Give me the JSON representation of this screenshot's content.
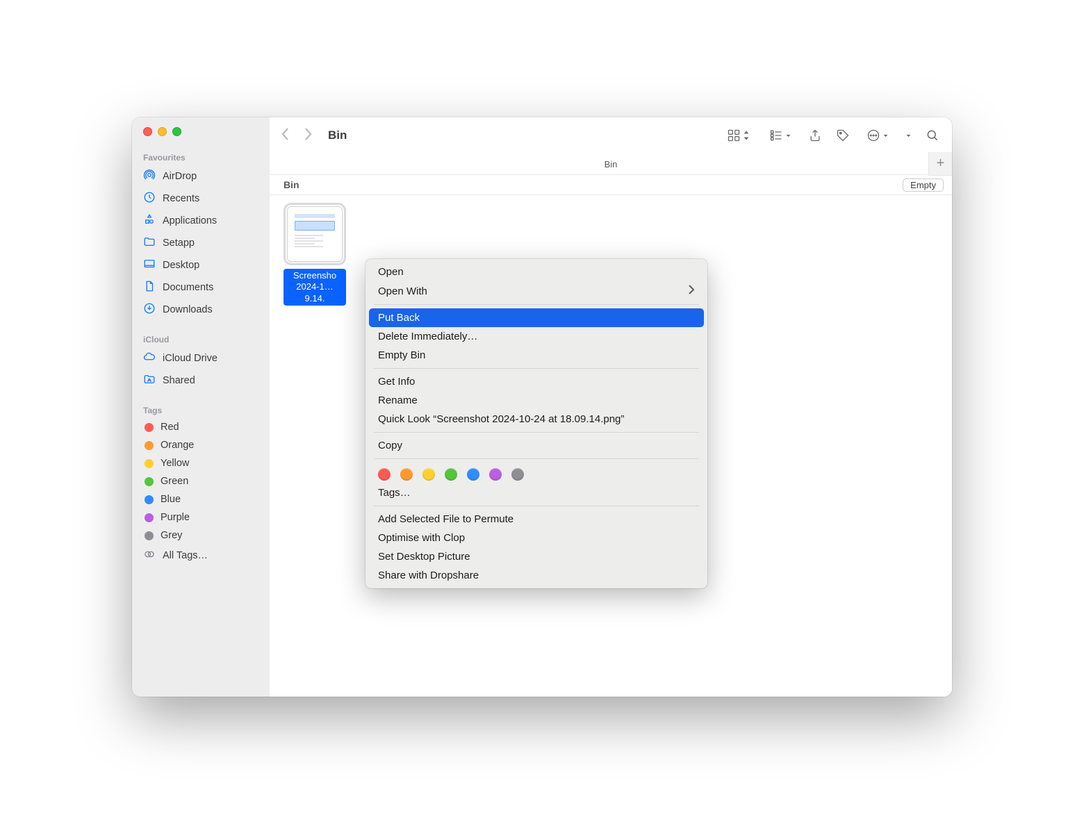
{
  "window": {
    "title": "Bin",
    "path": "Bin"
  },
  "sidebar": {
    "favourites_label": "Favourites",
    "favourites": [
      {
        "label": "AirDrop",
        "icon": "airdrop"
      },
      {
        "label": "Recents",
        "icon": "clock"
      },
      {
        "label": "Applications",
        "icon": "apps"
      },
      {
        "label": "Setapp",
        "icon": "folder"
      },
      {
        "label": "Desktop",
        "icon": "desktop"
      },
      {
        "label": "Documents",
        "icon": "document"
      },
      {
        "label": "Downloads",
        "icon": "download"
      }
    ],
    "icloud_label": "iCloud",
    "icloud": [
      {
        "label": "iCloud Drive",
        "icon": "cloud"
      },
      {
        "label": "Shared",
        "icon": "shared"
      }
    ],
    "tags_label": "Tags",
    "tags": [
      {
        "label": "Red",
        "color": "#ff5a52"
      },
      {
        "label": "Orange",
        "color": "#ff9a2e"
      },
      {
        "label": "Yellow",
        "color": "#ffd02e"
      },
      {
        "label": "Green",
        "color": "#53c63a"
      },
      {
        "label": "Blue",
        "color": "#2e8dff"
      },
      {
        "label": "Purple",
        "color": "#b95fe0"
      },
      {
        "label": "Grey",
        "color": "#8e8e92"
      }
    ],
    "all_tags": "All Tags…"
  },
  "header": {
    "bin_label": "Bin",
    "empty_label": "Empty"
  },
  "file": {
    "name_line1": "Screensho",
    "name_line2": "2024-1…9.14."
  },
  "context_menu": {
    "open": "Open",
    "open_with": "Open With",
    "put_back": "Put Back",
    "delete_immediately": "Delete Immediately…",
    "empty_bin": "Empty Bin",
    "get_info": "Get Info",
    "rename": "Rename",
    "quick_look": "Quick Look “Screenshot 2024-10-24 at 18.09.14.png”",
    "copy": "Copy",
    "tags_label": "Tags…",
    "tag_colors": [
      "#ff5a52",
      "#ff9a2e",
      "#ffd02e",
      "#53c63a",
      "#2e8dff",
      "#b95fe0",
      "#8e8e92"
    ],
    "add_permute": "Add Selected File to Permute",
    "optimise_clop": "Optimise with Clop",
    "set_desktop": "Set Desktop Picture",
    "share_dropshare": "Share with Dropshare"
  }
}
